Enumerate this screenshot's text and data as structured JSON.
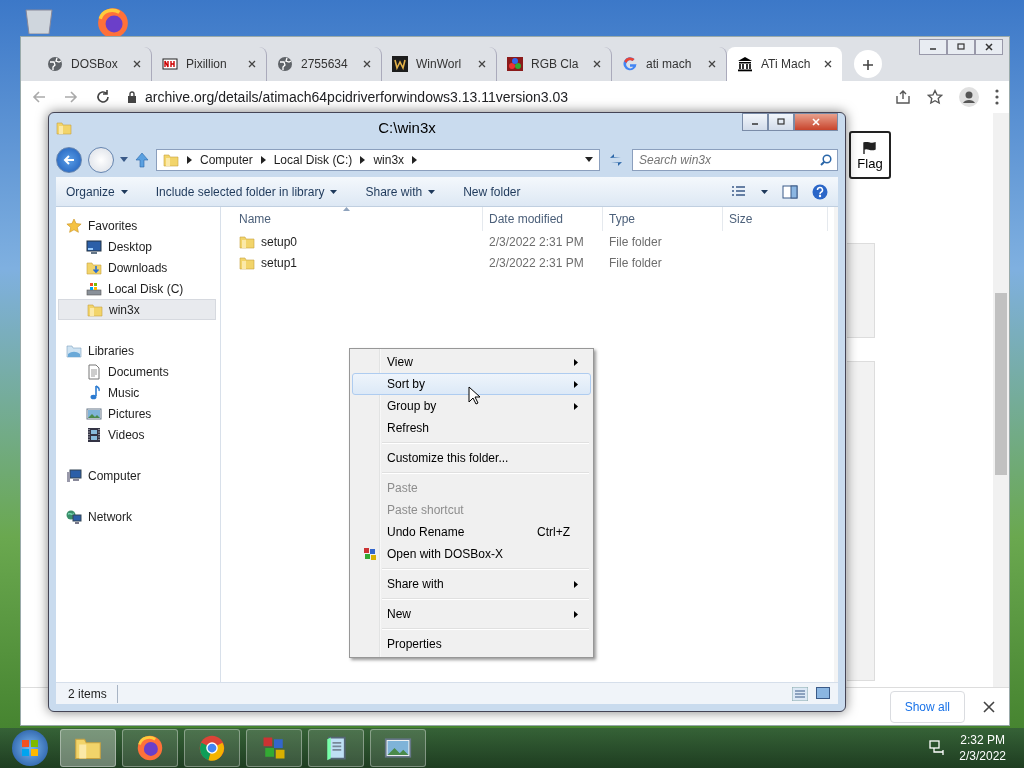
{
  "browser": {
    "tabs": [
      {
        "label": "DOSBox",
        "selected": false
      },
      {
        "label": "Pixillion",
        "selected": false
      },
      {
        "label": "2755634",
        "selected": false
      },
      {
        "label": "WinWorl",
        "selected": false
      },
      {
        "label": "RGB Cla",
        "selected": false
      },
      {
        "label": "ati mach",
        "selected": false
      },
      {
        "label": "ATi Mach",
        "selected": true
      }
    ],
    "address": "archive.org/details/atimach64pcidriverforwindows3.13.11version3.03",
    "flag_button": "Flag",
    "download_bar": {
      "show_all": "Show all"
    }
  },
  "explorer": {
    "title": "C:\\win3x",
    "breadcrumb": [
      "Computer",
      "Local Disk (C:)",
      "win3x"
    ],
    "search": {
      "placeholder": "Search win3x"
    },
    "toolbar": [
      {
        "label": "Organize",
        "dropdown": true
      },
      {
        "label": "Include selected folder in library",
        "dropdown": true
      },
      {
        "label": "Share with",
        "dropdown": true
      },
      {
        "label": "New folder",
        "dropdown": false
      }
    ],
    "nav": [
      {
        "label": "Favorites",
        "selected": false,
        "children": [
          {
            "label": "Desktop",
            "selected": false
          },
          {
            "label": "Downloads",
            "selected": false
          },
          {
            "label": "Local Disk (C)",
            "selected": false
          },
          {
            "label": "win3x",
            "selected": true
          }
        ]
      },
      {
        "label": "Libraries",
        "selected": false,
        "children": [
          {
            "label": "Documents",
            "selected": false
          },
          {
            "label": "Music",
            "selected": false
          },
          {
            "label": "Pictures",
            "selected": false
          },
          {
            "label": "Videos",
            "selected": false
          }
        ]
      },
      {
        "label": "Computer",
        "selected": false
      },
      {
        "label": "Network",
        "selected": false
      }
    ],
    "columns": [
      "Name",
      "Date modified",
      "Type",
      "Size"
    ],
    "rows": [
      {
        "name": "setup0",
        "date": "2/3/2022 2:31 PM",
        "type": "File folder"
      },
      {
        "name": "setup1",
        "date": "2/3/2022 2:31 PM",
        "type": "File folder"
      }
    ],
    "status": "2 items"
  },
  "context_menu": [
    {
      "kind": "item",
      "label": "View",
      "submenu": true,
      "disabled": false,
      "selected": false
    },
    {
      "kind": "item",
      "label": "Sort by",
      "submenu": true,
      "disabled": false,
      "selected": true
    },
    {
      "kind": "item",
      "label": "Group by",
      "submenu": true,
      "disabled": false,
      "selected": false
    },
    {
      "kind": "item",
      "label": "Refresh",
      "submenu": false,
      "disabled": false,
      "selected": false
    },
    {
      "kind": "separator"
    },
    {
      "kind": "item",
      "label": "Customize this folder...",
      "submenu": false,
      "disabled": false,
      "selected": false
    },
    {
      "kind": "separator"
    },
    {
      "kind": "item",
      "label": "Paste",
      "submenu": false,
      "disabled": true,
      "selected": false
    },
    {
      "kind": "item",
      "label": "Paste shortcut",
      "submenu": false,
      "disabled": true,
      "selected": false
    },
    {
      "kind": "item",
      "label": "Undo Rename",
      "shortcut": "Ctrl+Z",
      "submenu": false,
      "disabled": false,
      "selected": false
    },
    {
      "kind": "app",
      "label": "Open with DOSBox-X",
      "submenu": false,
      "disabled": false,
      "selected": false
    },
    {
      "kind": "separator"
    },
    {
      "kind": "item",
      "label": "Share with",
      "submenu": true,
      "disabled": false,
      "selected": false
    },
    {
      "kind": "separator"
    },
    {
      "kind": "item",
      "label": "New",
      "submenu": true,
      "disabled": false,
      "selected": false
    },
    {
      "kind": "separator"
    },
    {
      "kind": "item",
      "label": "Properties",
      "submenu": false,
      "disabled": false,
      "selected": false
    }
  ],
  "taskbar": {
    "apps": [
      {
        "selected": true
      },
      {
        "selected": false
      },
      {
        "selected": false
      },
      {
        "selected": false
      },
      {
        "selected": false
      },
      {
        "selected": false
      }
    ],
    "time": "2:32 PM",
    "date": "2/3/2022"
  }
}
